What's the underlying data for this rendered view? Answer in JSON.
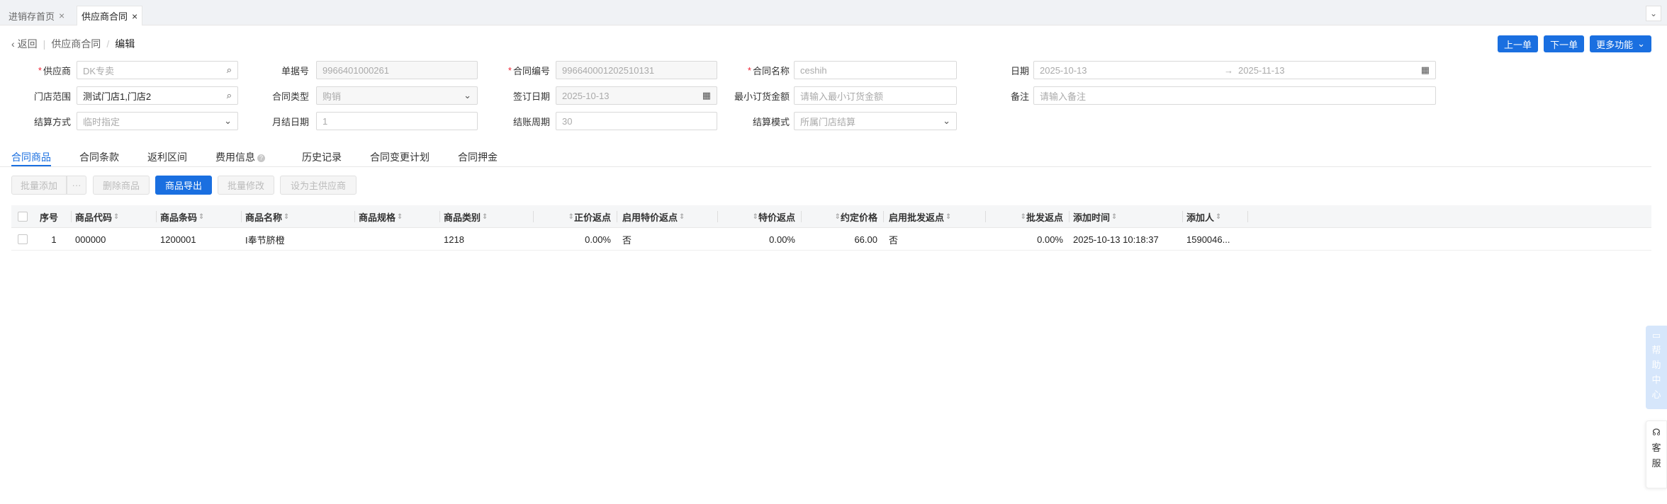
{
  "tabs": [
    {
      "label": "进销存首页"
    },
    {
      "label": "供应商合同"
    }
  ],
  "breadcrumb": {
    "back": "返回",
    "parent": "供应商合同",
    "current": "编辑"
  },
  "actions": {
    "prev": "上一单",
    "next": "下一单",
    "more": "更多功能"
  },
  "form": {
    "supplier": {
      "label": "供应商",
      "placeholder": "DK专卖"
    },
    "doc_no": {
      "label": "单据号",
      "value": "9966401000261"
    },
    "contract_no": {
      "label": "合同编号",
      "value": "996640001202510131"
    },
    "contract_name": {
      "label": "合同名称",
      "value": "ceshih"
    },
    "date": {
      "label": "日期",
      "start": "2025-10-13",
      "arrow": "→",
      "end": "2025-11-13"
    },
    "store_range": {
      "label": "门店范围",
      "value": "测试门店1,门店2"
    },
    "contract_type": {
      "label": "合同类型",
      "value": "购销"
    },
    "sign_date": {
      "label": "签订日期",
      "value": "2025-10-13"
    },
    "min_order": {
      "label": "最小订货金额",
      "placeholder": "请输入最小订货金额"
    },
    "remark": {
      "label": "备注",
      "placeholder": "请输入备注"
    },
    "settle_method": {
      "label": "结算方式",
      "value": "临时指定"
    },
    "month_day": {
      "label": "月结日期",
      "value": "1"
    },
    "settle_period": {
      "label": "结账周期",
      "value": "30"
    },
    "settle_mode": {
      "label": "结算模式",
      "value": "所属门店结算"
    }
  },
  "subtabs": [
    "合同商品",
    "合同条款",
    "返利区间",
    "费用信息",
    "历史记录",
    "合同变更计划",
    "合同押金"
  ],
  "toolbar": {
    "batch_add": "批量添加",
    "more": "···",
    "delete": "删除商品",
    "export": "商品导出",
    "batch_edit": "批量修改",
    "set_main": "设为主供应商"
  },
  "table": {
    "headers": {
      "seq": "序号",
      "code": "商品代码",
      "barcode": "商品条码",
      "name": "商品名称",
      "spec": "商品规格",
      "category": "商品类别",
      "rebate": "正价返点",
      "special_enable": "启用特价返点",
      "special_rebate": "特价返点",
      "agreed_price": "约定价格",
      "wholesale_enable": "启用批发返点",
      "wholesale_rebate": "批发返点",
      "add_time": "添加时间",
      "adder": "添加人"
    },
    "rows": [
      {
        "seq": "1",
        "code": "000000",
        "barcode": "1200001",
        "name": "I奉节脐橙",
        "spec": "",
        "category": "1218",
        "rebate": "0.00%",
        "special_enable": "否",
        "special_rebate": "0.00%",
        "agreed_price": "66.00",
        "wholesale_enable": "否",
        "wholesale_rebate": "0.00%",
        "add_time": "2025-10-13 10:18:37",
        "adder": "1590046..."
      }
    ]
  },
  "float": {
    "help": [
      "帮",
      "助",
      "中",
      "心"
    ],
    "service": [
      "客",
      "服"
    ]
  },
  "colors": {
    "primary": "#1a6fe0",
    "required": "#ee2233"
  }
}
